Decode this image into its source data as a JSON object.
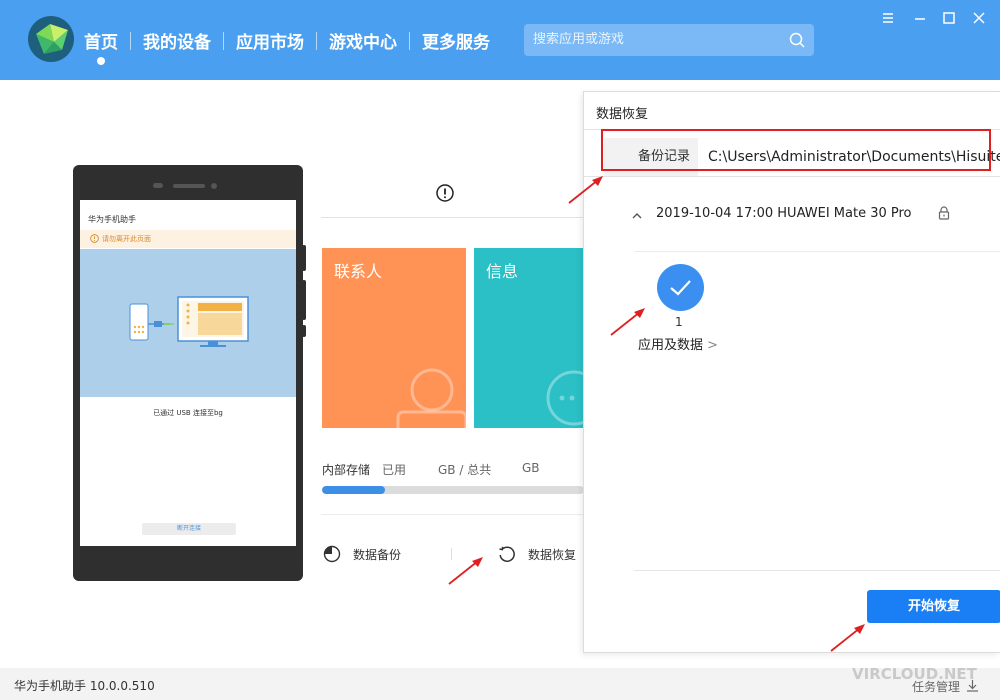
{
  "header": {
    "nav": [
      {
        "label": "首页",
        "active": true
      },
      {
        "label": "我的设备",
        "active": false
      },
      {
        "label": "应用市场",
        "active": false
      },
      {
        "label": "游戏中心",
        "active": false
      },
      {
        "label": "更多服务",
        "active": false
      }
    ],
    "search_placeholder": "搜索应用或游戏",
    "window_controls": [
      "menu-icon",
      "minimize-icon",
      "maximize-icon",
      "close-icon"
    ]
  },
  "phone": {
    "app_title": "华为手机助手",
    "warning": "请勿离开此页面",
    "usb_status": "已通过 USB 连接至bg",
    "disconnect": "断开连接"
  },
  "tiles": [
    {
      "label": "联系人",
      "color": "#ff9356"
    },
    {
      "label": "信息",
      "color": "#2bbfc6"
    }
  ],
  "storage": {
    "label": "内部存储",
    "used": "已用",
    "unit_total": "GB / 总共",
    "unit_gb": "GB",
    "progress": 0.24
  },
  "actions": {
    "backup": "数据备份",
    "restore": "数据恢复"
  },
  "restore_panel": {
    "title": "数据恢复",
    "record_label": "备份记录",
    "record_path": "C:\\Users\\Administrator\\Documents\\Hisuite\\",
    "backup_entry": "2019-10-04 17:00 HUAWEI Mate 30 Pro",
    "item_count": "1",
    "item_label": "应用及数据",
    "item_arrow": ">",
    "start_button": "开始恢复"
  },
  "footer": {
    "version": "华为手机助手 10.0.0.510",
    "task_manager": "任务管理",
    "watermark": "VIRCLOUD.NET"
  },
  "colors": {
    "header": "#4a9ff0",
    "accent": "#1a7ff5",
    "annotation": "#e02020"
  }
}
